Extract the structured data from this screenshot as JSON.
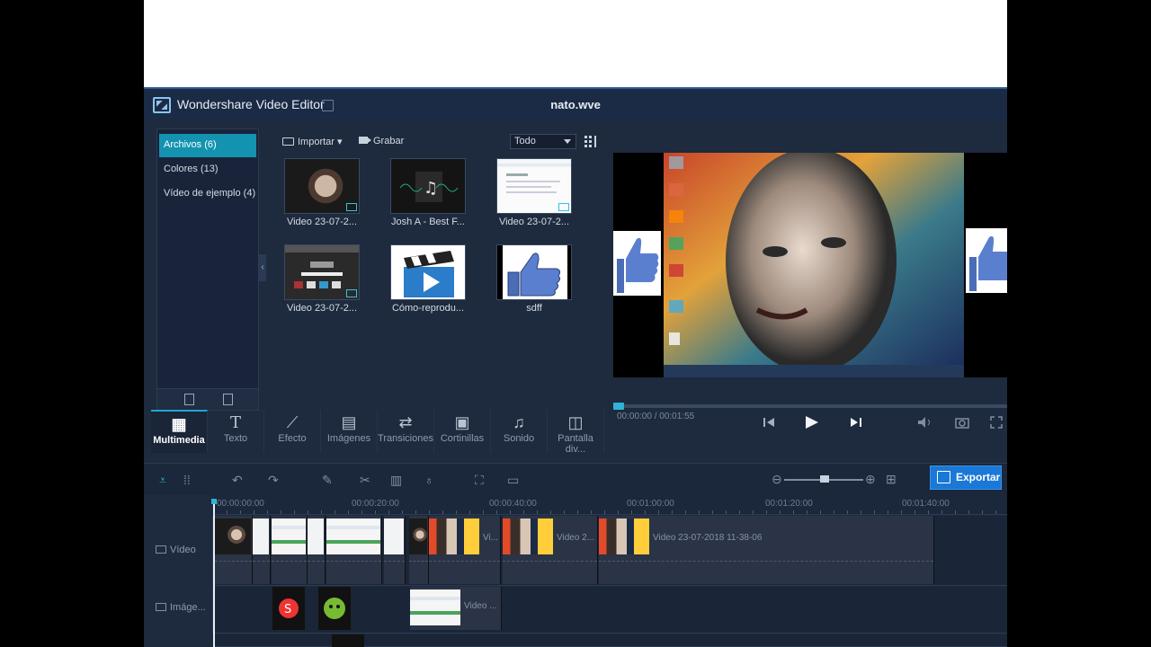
{
  "window": {
    "app_title": "Wondershare Video Editor",
    "document_title": "nato.wve"
  },
  "categories": [
    {
      "label": "Archivos (6)",
      "active": true
    },
    {
      "label": "Colores (13)",
      "active": false
    },
    {
      "label": "Vídeo de ejemplo (4)",
      "active": false
    }
  ],
  "library_toolbar": {
    "import_label": "Importar",
    "record_label": "Grabar",
    "filter_value": "Todo"
  },
  "media_items": [
    {
      "label": "Video 23-07-2...",
      "kind": "face"
    },
    {
      "label": "Josh A - Best F...",
      "kind": "music"
    },
    {
      "label": "Video 23-07-2...",
      "kind": "screen"
    },
    {
      "label": "Video 23-07-2...",
      "kind": "google"
    },
    {
      "label": "Cómo-reprodu...",
      "kind": "clapper"
    },
    {
      "label": "sdff",
      "kind": "thumbs-up"
    }
  ],
  "tabs": [
    {
      "label": "Multimedia",
      "icon": "film-music-icon",
      "active": true
    },
    {
      "label": "Texto",
      "icon": "text-icon",
      "active": false
    },
    {
      "label": "Efecto",
      "icon": "magic-wand-icon",
      "active": false
    },
    {
      "label": "Imágenes",
      "icon": "filmstrip-icon",
      "active": false
    },
    {
      "label": "Transiciones",
      "icon": "transition-icon",
      "active": false
    },
    {
      "label": "Cortinillas",
      "icon": "clapper-icon",
      "active": false
    },
    {
      "label": "Sonido",
      "icon": "headphones-icon",
      "active": false
    },
    {
      "label": "Pantalla div...",
      "icon": "split-screen-icon",
      "active": false
    }
  ],
  "player": {
    "timecode": "00:00:00 / 00:01:55"
  },
  "timeline": {
    "export_label": "Exportar",
    "ruler_labels": [
      "00:00:00:00",
      "00:00:20:00",
      "00:00:40:00",
      "00:01:00:00",
      "00:01:20:00",
      "00:01:40:00"
    ],
    "tracks": [
      {
        "label": "Vídeo",
        "icon": "video-track-icon"
      },
      {
        "label": "Imáge...",
        "icon": "image-track-icon"
      }
    ],
    "video_clip_labels": [
      "Vi...",
      "Video 2...",
      "Video 23-07-2018 11-38-06"
    ],
    "image_clip_label": "Video ..."
  },
  "colors": {
    "accent": "#1493b0",
    "export": "#1a78d6",
    "background": "#1e2a3d"
  }
}
